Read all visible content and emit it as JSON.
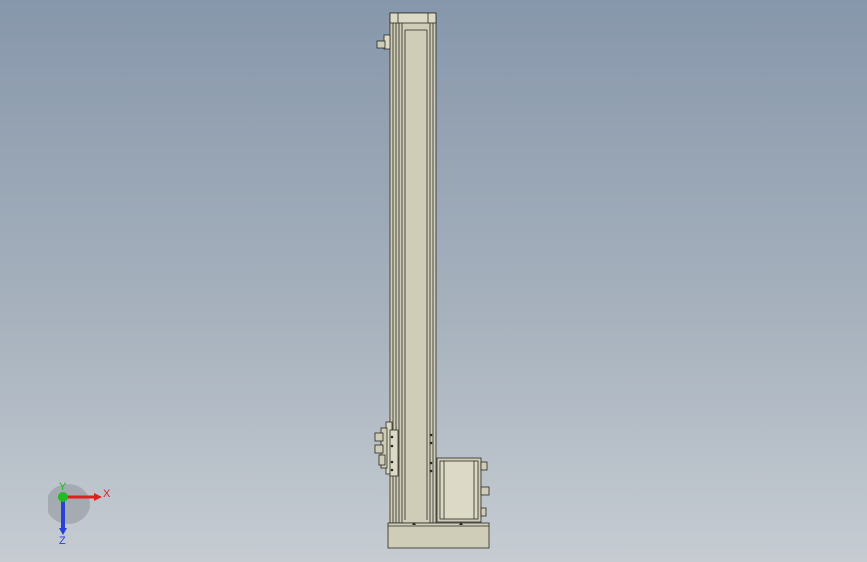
{
  "scene": {
    "kind": "cad-model-view"
  },
  "triad": {
    "x_label": "X",
    "y_label": "Y",
    "z_label": "Z",
    "x_color": "#e02020",
    "y_color": "#22bb22",
    "z_color": "#2a3fd8"
  },
  "colors": {
    "part_fill": "#cfcdb8",
    "part_light": "#dcdac6",
    "part_dark": "#9e9c88",
    "edge": "#2a2a22"
  }
}
